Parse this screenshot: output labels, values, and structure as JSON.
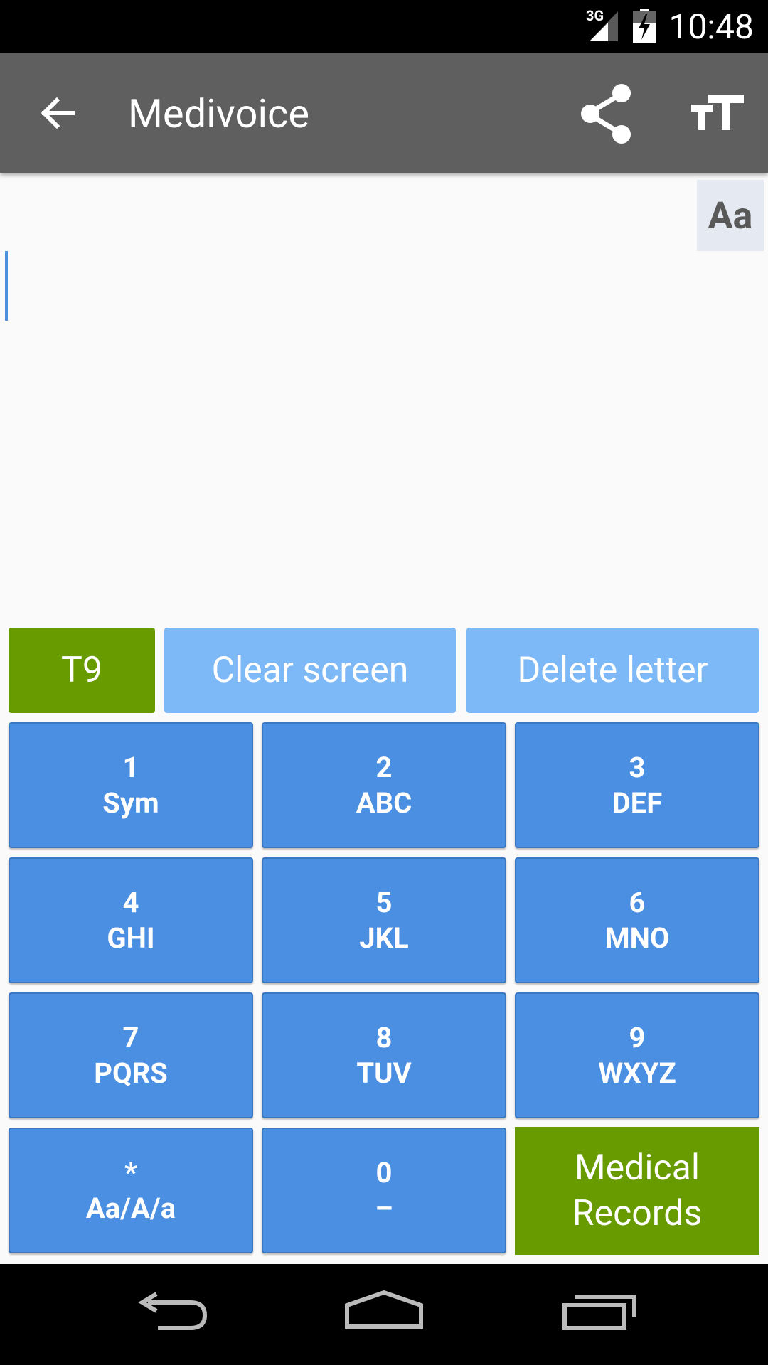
{
  "status_bar": {
    "network": "3G",
    "time": "10:48"
  },
  "action_bar": {
    "title": "Medivoice"
  },
  "text_area": {
    "case_button": "Aa"
  },
  "controls": {
    "t9_label": "T9",
    "clear_label": "Clear screen",
    "delete_label": "Delete letter"
  },
  "keys": [
    {
      "digit": "1",
      "letters": "Sym"
    },
    {
      "digit": "2",
      "letters": "ABC"
    },
    {
      "digit": "3",
      "letters": "DEF"
    },
    {
      "digit": "4",
      "letters": "GHI"
    },
    {
      "digit": "5",
      "letters": "JKL"
    },
    {
      "digit": "6",
      "letters": "MNO"
    },
    {
      "digit": "7",
      "letters": "PQRS"
    },
    {
      "digit": "8",
      "letters": "TUV"
    },
    {
      "digit": "9",
      "letters": "WXYZ"
    },
    {
      "digit": "*",
      "letters": "Aa/A/a"
    },
    {
      "digit": "0",
      "letters": "–"
    }
  ],
  "medical_records": {
    "line1": "Medical",
    "line2": "Records"
  },
  "colors": {
    "action_bar": "#5f5f5f",
    "key_blue": "#4a8fe2",
    "light_blue": "#7db8f7",
    "green": "#689b00"
  }
}
